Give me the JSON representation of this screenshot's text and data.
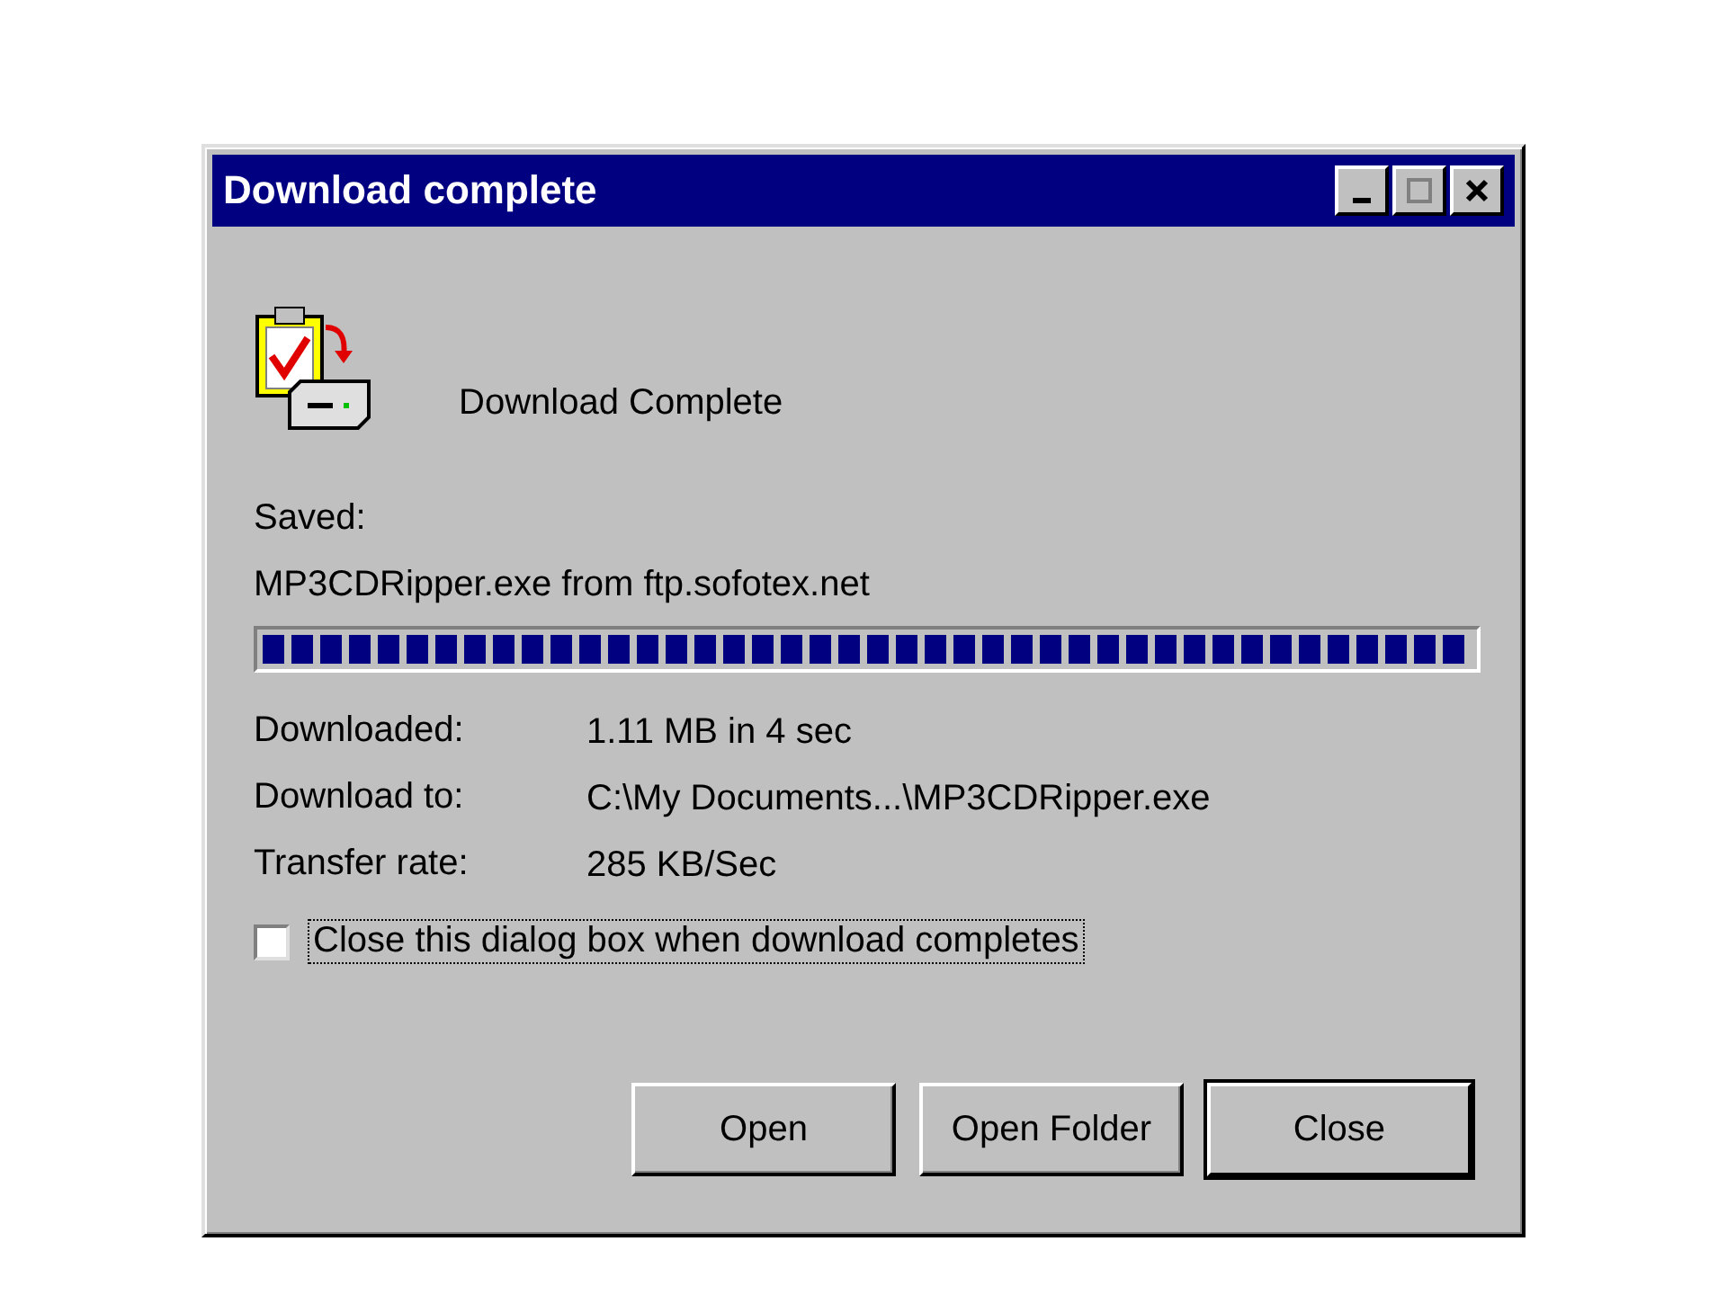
{
  "window": {
    "title": "Download complete",
    "controls": [
      {
        "kind": "minimize",
        "disabled": false
      },
      {
        "kind": "maximize",
        "disabled": true
      },
      {
        "kind": "close",
        "disabled": false
      }
    ]
  },
  "heading": "Download Complete",
  "saved_label": "Saved:",
  "saved_file": "MP3CDRipper.exe from ftp.sofotex.net",
  "progress": {
    "level": 1
  },
  "details": [
    {
      "label": "Downloaded:",
      "value": "1.11 MB in 4 sec"
    },
    {
      "label": "Download to:",
      "value": "C:\\My Documents...\\MP3CDRipper.exe"
    },
    {
      "label": "Transfer rate:",
      "value": "285 KB/Sec"
    }
  ],
  "close_when_done": {
    "label": "Close this dialog box when download completes",
    "checked": false,
    "focused": true
  },
  "buttons": [
    {
      "label": "Open",
      "default": false
    },
    {
      "label": "Open Folder",
      "default": false
    },
    {
      "label": "Close",
      "default": true
    }
  ]
}
